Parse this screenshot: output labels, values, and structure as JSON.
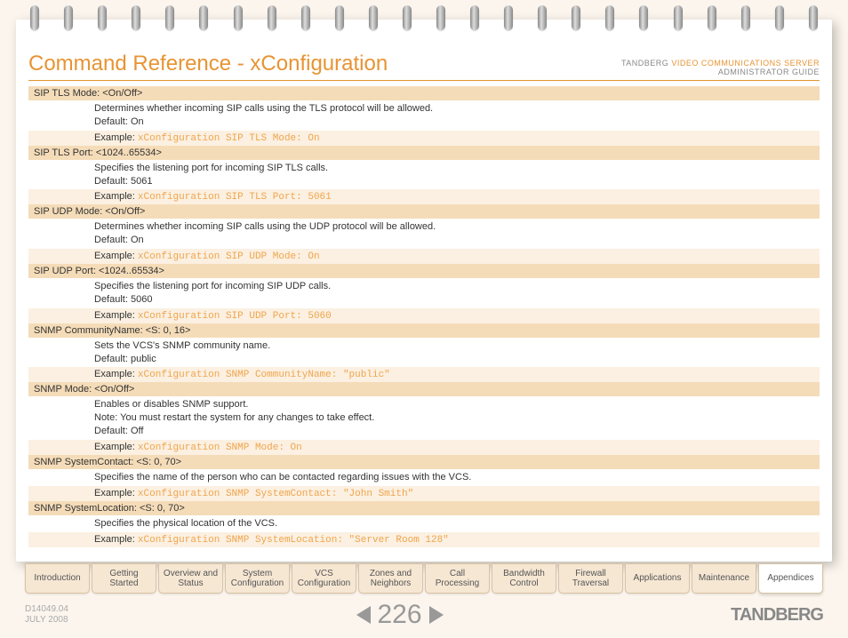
{
  "header": {
    "title": "Command Reference - xConfiguration",
    "company": "TANDBERG",
    "product": "VIDEO COMMUNICATIONS SERVER",
    "subtitle": "ADMINISTRATOR GUIDE"
  },
  "commands": [
    {
      "name": "SIP TLS Mode: <On/Off>",
      "desc": "Determines whether incoming SIP calls using the TLS protocol will be allowed.\nDefault: On",
      "example_label": "Example:",
      "example_code": "xConfiguration SIP TLS Mode: On"
    },
    {
      "name": "SIP TLS Port: <1024..65534>",
      "desc": "Specifies the listening port for incoming SIP TLS calls.\nDefault: 5061",
      "example_label": "Example:",
      "example_code": "xConfiguration SIP TLS Port: 5061"
    },
    {
      "name": "SIP UDP Mode: <On/Off>",
      "desc": "Determines whether incoming SIP calls using the UDP protocol will be allowed.\nDefault: On",
      "example_label": "Example:",
      "example_code": "xConfiguration SIP UDP Mode: On"
    },
    {
      "name": "SIP UDP Port: <1024..65534>",
      "desc": "Specifies the listening port for incoming SIP UDP calls.\nDefault: 5060",
      "example_label": "Example:",
      "example_code": "xConfiguration SIP UDP Port: 5060"
    },
    {
      "name": "SNMP CommunityName: <S: 0, 16>",
      "desc": "Sets the VCS's SNMP community name.\nDefault: public",
      "example_label": "Example:",
      "example_code": "xConfiguration SNMP CommunityName: \"public\""
    },
    {
      "name": "SNMP Mode: <On/Off>",
      "desc": "Enables or disables SNMP support.\nNote: You must restart the system for any changes to take effect.\nDefault: Off",
      "example_label": "Example:",
      "example_code": "xConfiguration SNMP Mode: On"
    },
    {
      "name": "SNMP SystemContact: <S: 0, 70>",
      "desc": "Specifies the name of the person who can be contacted regarding issues with the VCS.",
      "example_label": "Example:",
      "example_code": "xConfiguration SNMP SystemContact: \"John Smith\""
    },
    {
      "name": "SNMP SystemLocation: <S: 0, 70>",
      "desc": "Specifies the physical location of the VCS.",
      "example_label": "Example:",
      "example_code": "xConfiguration SNMP SystemLocation: \"Server Room 128\""
    }
  ],
  "tabs": [
    {
      "label": "Introduction"
    },
    {
      "label": "Getting Started"
    },
    {
      "label": "Overview and\nStatus"
    },
    {
      "label": "System\nConfiguration"
    },
    {
      "label": "VCS\nConfiguration"
    },
    {
      "label": "Zones and\nNeighbors"
    },
    {
      "label": "Call\nProcessing"
    },
    {
      "label": "Bandwidth\nControl"
    },
    {
      "label": "Firewall\nTraversal"
    },
    {
      "label": "Applications"
    },
    {
      "label": "Maintenance"
    },
    {
      "label": "Appendices",
      "active": true
    }
  ],
  "footer": {
    "doc_id": "D14049.04",
    "date": "JULY 2008",
    "page": "226",
    "brand": "TANDBERG"
  }
}
